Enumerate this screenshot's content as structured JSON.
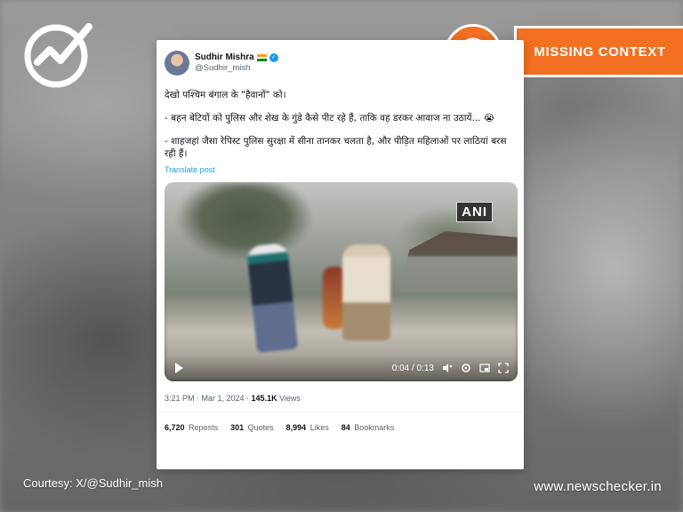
{
  "overlay": {
    "badge_label": "MISSING CONTEXT",
    "courtesy": "Courtesy: X/@Sudhir_mish",
    "site": "www.newschecker.in",
    "accent_color": "#f36f21"
  },
  "tweet": {
    "author_name": "Sudhir Mishra",
    "author_flag": "🇮🇳",
    "handle": "@Sudhir_mish",
    "paragraph_1": "देखो पश्चिम बंगाल के \"हैवानों\" को।",
    "paragraph_2": "- बहन बेटियों को पुलिस और शेख के गुंडे कैसे पीट रहे हैं, ताकि वह डरकर आवाज ना उठायें... 😭",
    "paragraph_3": "- शाहजहां जैसा रेपिस्ट पुलिस सुरक्षा में सीना तानकर चलता है, और पीड़ित महिलाओं पर लाठियां बरस रही हैं।",
    "translate": "Translate post",
    "video": {
      "watermark": "ANI",
      "time": "0:04 / 0:13"
    },
    "timestamp": "3:21 PM · Mar 1, 2024 · ",
    "views_count": "145.1K",
    "views_label": " Views",
    "stats": {
      "reposts_count": "6,720",
      "reposts_label": "Reposts",
      "quotes_count": "301",
      "quotes_label": "Quotes",
      "likes_count": "8,994",
      "likes_label": "Likes",
      "bookmarks_count": "84",
      "bookmarks_label": "Bookmarks"
    }
  }
}
